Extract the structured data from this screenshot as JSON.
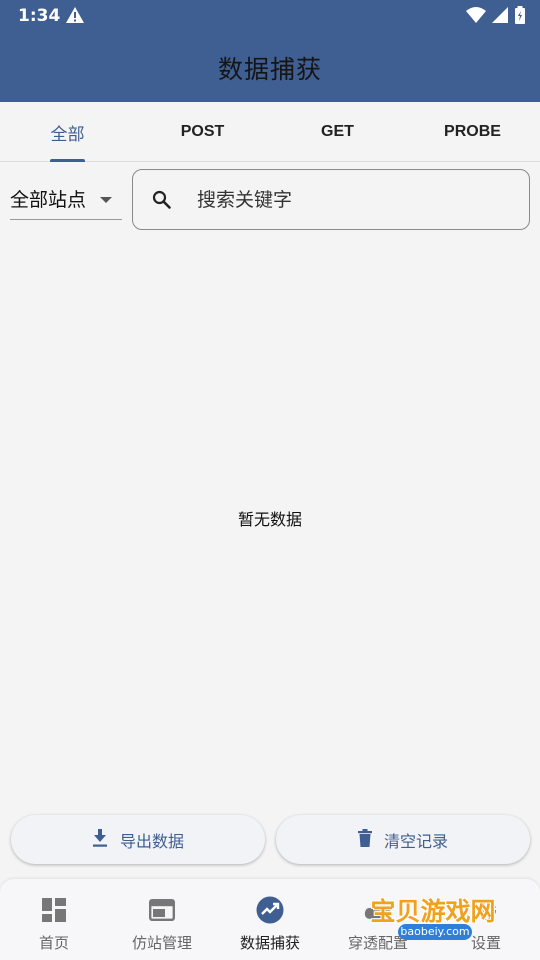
{
  "status_bar": {
    "time": "1:34",
    "icons": [
      "warning-icon",
      "wifi-icon",
      "signal-icon",
      "battery-icon"
    ]
  },
  "app_bar": {
    "title": "数据捕获"
  },
  "tabs": [
    {
      "label": "全部",
      "active": true
    },
    {
      "label": "POST",
      "active": false
    },
    {
      "label": "GET",
      "active": false
    },
    {
      "label": "PROBE",
      "active": false
    }
  ],
  "filter": {
    "site_select": "全部站点",
    "search_placeholder": "搜索关键字"
  },
  "empty_state": {
    "text": "暂无数据"
  },
  "actions": {
    "export_label": "导出数据",
    "clear_label": "清空记录"
  },
  "bottom_nav": [
    {
      "label": "首页",
      "icon": "dashboard-icon",
      "active": false
    },
    {
      "label": "仿站管理",
      "icon": "web-icon",
      "active": false
    },
    {
      "label": "数据捕获",
      "icon": "trending-up-icon",
      "active": true
    },
    {
      "label": "穿透配置",
      "icon": "cloud-icon",
      "active": false
    },
    {
      "label": "设置",
      "icon": "settings-icon",
      "active": false
    }
  ],
  "watermark": {
    "text": "宝贝游戏网",
    "url": "baobeiy.com"
  },
  "colors": {
    "primary": "#3f5e91",
    "background": "#f4f4f4"
  }
}
